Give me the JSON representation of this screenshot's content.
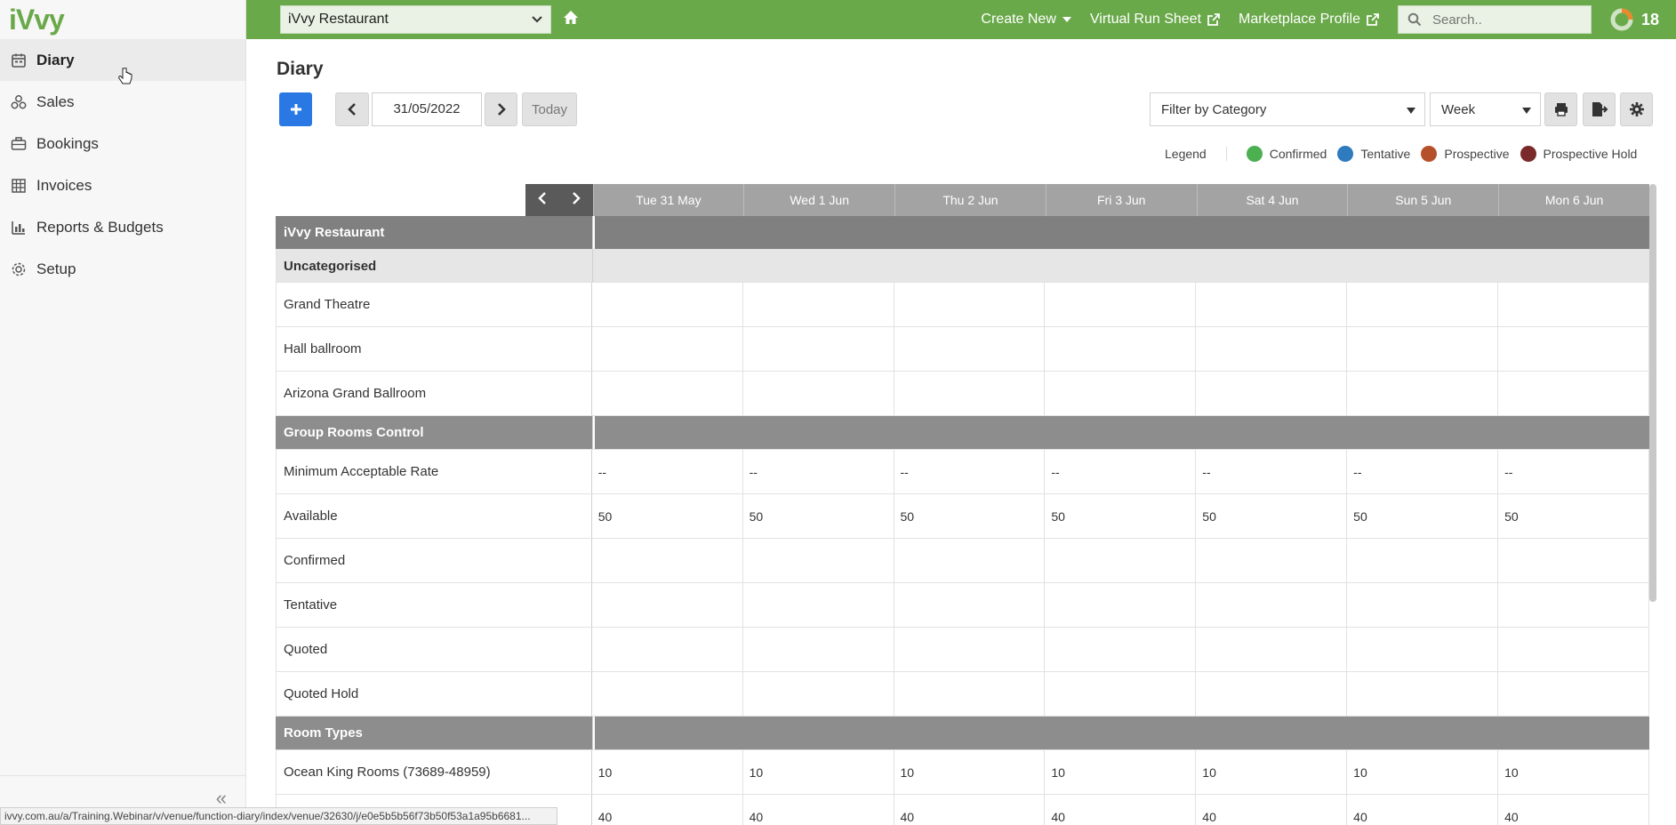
{
  "brand": {
    "logo": "iVvy"
  },
  "sidebar": {
    "items": [
      {
        "label": "Diary",
        "icon": "calendar-icon",
        "active": true
      },
      {
        "label": "Sales",
        "icon": "sales-icon"
      },
      {
        "label": "Bookings",
        "icon": "briefcase-icon"
      },
      {
        "label": "Invoices",
        "icon": "invoice-icon"
      },
      {
        "label": "Reports & Budgets",
        "icon": "bar-chart-icon"
      },
      {
        "label": "Setup",
        "icon": "gear-icon"
      }
    ]
  },
  "topbar": {
    "venue": "iVvy Restaurant",
    "create_new": "Create New",
    "virtual_run_sheet": "Virtual Run Sheet",
    "marketplace_profile": "Marketplace Profile",
    "search_placeholder": "Search..",
    "notification_count": "18"
  },
  "page": {
    "title": "Diary",
    "date": "31/05/2022",
    "today_label": "Today",
    "filter_placeholder": "Filter by Category",
    "view": "Week"
  },
  "legend": {
    "title": "Legend",
    "items": [
      {
        "label": "Confirmed",
        "color": "#4caf50"
      },
      {
        "label": "Tentative",
        "color": "#2f7bbf"
      },
      {
        "label": "Prospective",
        "color": "#b5512a"
      },
      {
        "label": "Prospective Hold",
        "color": "#7a2a2a"
      }
    ]
  },
  "grid": {
    "days": [
      "Tue 31 May",
      "Wed 1 Jun",
      "Thu 2 Jun",
      "Fri 3 Jun",
      "Sat 4 Jun",
      "Sun 5 Jun",
      "Mon 6 Jun"
    ],
    "venue": "iVvy Restaurant",
    "category": "Uncategorised",
    "spaces": [
      "Grand Theatre",
      "Hall ballroom",
      "Arizona Grand Ballroom"
    ],
    "group_rooms_title": "Group Rooms Control",
    "group_rows": [
      {
        "label": "Minimum Acceptable Rate",
        "values": [
          "--",
          "--",
          "--",
          "--",
          "--",
          "--",
          "--"
        ]
      },
      {
        "label": "Available",
        "values": [
          "50",
          "50",
          "50",
          "50",
          "50",
          "50",
          "50"
        ]
      },
      {
        "label": "Confirmed",
        "values": [
          "",
          "",
          "",
          "",
          "",
          "",
          ""
        ]
      },
      {
        "label": "Tentative",
        "values": [
          "",
          "",
          "",
          "",
          "",
          "",
          ""
        ]
      },
      {
        "label": "Quoted",
        "values": [
          "",
          "",
          "",
          "",
          "",
          "",
          ""
        ]
      },
      {
        "label": "Quoted Hold",
        "values": [
          "",
          "",
          "",
          "",
          "",
          "",
          ""
        ]
      }
    ],
    "room_types_title": "Room Types",
    "room_rows": [
      {
        "label": "Ocean King Rooms (73689-48959)",
        "values": [
          "10",
          "10",
          "10",
          "10",
          "10",
          "10",
          "10"
        ]
      },
      {
        "label": "",
        "values": [
          "40",
          "40",
          "40",
          "40",
          "40",
          "40",
          "40"
        ]
      }
    ]
  },
  "status_url": "ivvy.com.au/a/Training.Webinar/v/venue/function-diary/index/venue/32630/j/e0e5b5b56f73b50f53a1a95b6681..."
}
